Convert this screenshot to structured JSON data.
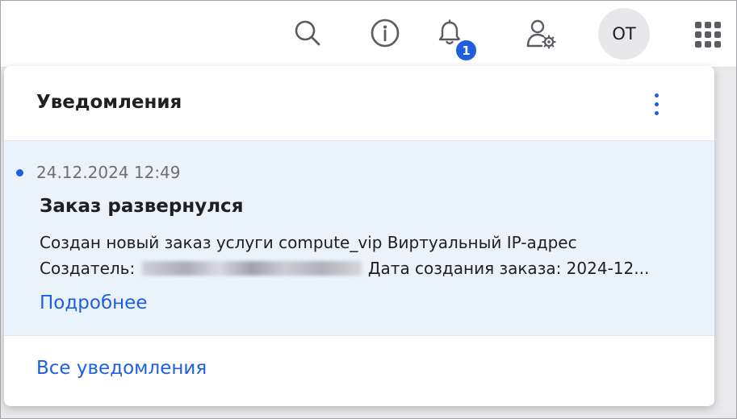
{
  "topbar": {
    "icons": [
      "search-icon",
      "info-icon",
      "bell-icon",
      "user-settings-icon",
      "apps-grid-icon"
    ],
    "notification_count": "1",
    "avatar_initials": "ОТ"
  },
  "panel": {
    "title": "Уведомления",
    "notification": {
      "timestamp": "24.12.2024 12:49",
      "title": "Заказ развернулся",
      "line1": "Создан новый заказ услуги compute_vip Виртуальный IP-адрес",
      "creator_label": "Создатель:",
      "date_label": "Дата создания заказа: 2024-12...",
      "more_link": "Подробнее"
    },
    "all_link": "Все уведомления"
  },
  "colors": {
    "accent": "#1d5fe0",
    "unread_bg": "#eaf2fc",
    "text": "#1f1f23",
    "muted": "#6f6f75"
  }
}
